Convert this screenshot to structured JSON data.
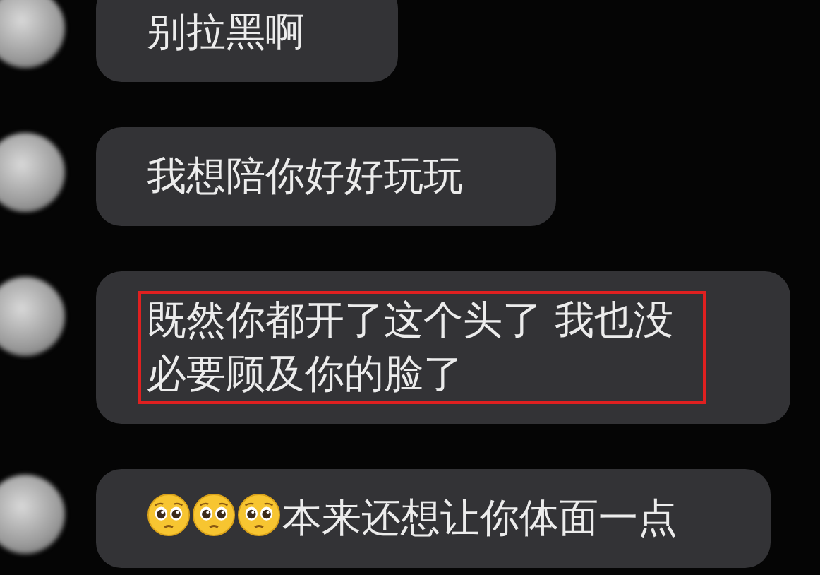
{
  "messages": [
    {
      "text": "别拉黑啊",
      "highlighted": false
    },
    {
      "text": "我想陪你好好玩玩",
      "highlighted": false
    },
    {
      "text": "既然你都开了这个头了 我也没必要顾及你的脸了",
      "highlighted": true
    },
    {
      "text": "本来还想让你体面一点",
      "highlighted": false,
      "leading_icons": [
        {
          "kind": "pleading-face"
        },
        {
          "kind": "pleading-face"
        },
        {
          "kind": "pleading-face"
        }
      ]
    }
  ]
}
